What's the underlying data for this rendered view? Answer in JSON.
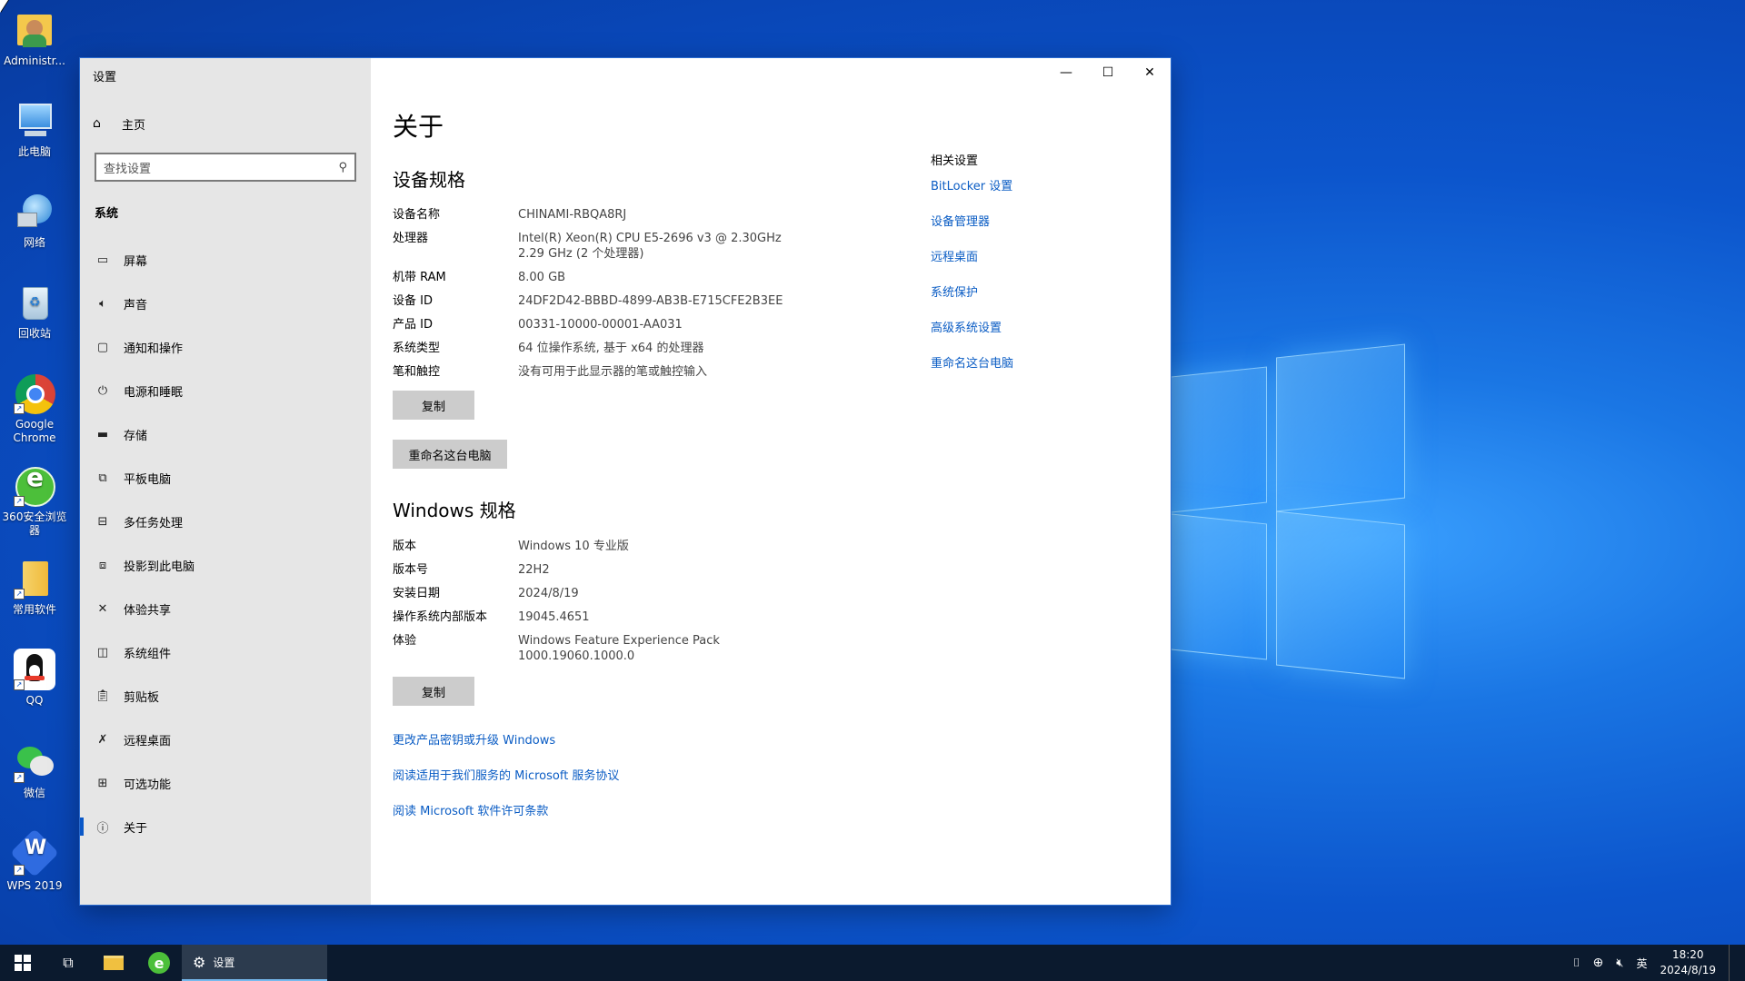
{
  "desktop": {
    "icons": [
      {
        "label": "Administr...",
        "name": "administrator-folder"
      },
      {
        "label": "此电脑",
        "name": "this-pc"
      },
      {
        "label": "网络",
        "name": "network"
      },
      {
        "label": "回收站",
        "name": "recycle-bin"
      },
      {
        "label": "Google Chrome",
        "name": "google-chrome"
      },
      {
        "label": "360安全浏览器",
        "name": "360-browser"
      },
      {
        "label": "常用软件",
        "name": "common-software"
      },
      {
        "label": "QQ",
        "name": "qq"
      },
      {
        "label": "微信",
        "name": "wechat"
      },
      {
        "label": "WPS 2019",
        "name": "wps-2019"
      }
    ]
  },
  "window": {
    "title": "设置",
    "controls": {
      "minimize": "—",
      "maximize": "☐",
      "close": "✕"
    }
  },
  "sidebar": {
    "home_label": "主页",
    "search_placeholder": "查找设置",
    "section": "系统",
    "items": [
      {
        "label": "屏幕",
        "icon": "monitor-icon"
      },
      {
        "label": "声音",
        "icon": "speaker-icon"
      },
      {
        "label": "通知和操作",
        "icon": "notification-icon"
      },
      {
        "label": "电源和睡眠",
        "icon": "power-icon"
      },
      {
        "label": "存储",
        "icon": "storage-icon"
      },
      {
        "label": "平板电脑",
        "icon": "tablet-icon"
      },
      {
        "label": "多任务处理",
        "icon": "multitask-icon"
      },
      {
        "label": "投影到此电脑",
        "icon": "project-icon"
      },
      {
        "label": "体验共享",
        "icon": "share-icon"
      },
      {
        "label": "系统组件",
        "icon": "components-icon"
      },
      {
        "label": "剪贴板",
        "icon": "clipboard-icon"
      },
      {
        "label": "远程桌面",
        "icon": "remote-desktop-icon"
      },
      {
        "label": "可选功能",
        "icon": "optional-features-icon"
      },
      {
        "label": "关于",
        "icon": "info-icon"
      }
    ]
  },
  "main": {
    "title": "关于",
    "device_specs": {
      "heading": "设备规格",
      "rows": [
        {
          "key": "设备名称",
          "value": "CHINAMI-RBQA8RJ"
        },
        {
          "key": "处理器",
          "value": "Intel(R) Xeon(R) CPU E5-2696 v3 @ 2.30GHz   2.29 GHz  (2 个处理器)"
        },
        {
          "key": "机带 RAM",
          "value": "8.00 GB"
        },
        {
          "key": "设备 ID",
          "value": "24DF2D42-BBBD-4899-AB3B-E715CFE2B3EE"
        },
        {
          "key": "产品 ID",
          "value": "00331-10000-00001-AA031"
        },
        {
          "key": "系统类型",
          "value": "64 位操作系统, 基于 x64 的处理器"
        },
        {
          "key": "笔和触控",
          "value": "没有可用于此显示器的笔或触控输入"
        }
      ],
      "copy_button": "复制",
      "rename_button": "重命名这台电脑"
    },
    "windows_specs": {
      "heading": "Windows 规格",
      "rows": [
        {
          "key": "版本",
          "value": "Windows 10 专业版"
        },
        {
          "key": "版本号",
          "value": "22H2"
        },
        {
          "key": "安装日期",
          "value": "2024/8/19"
        },
        {
          "key": "操作系统内部版本",
          "value": "19045.4651"
        },
        {
          "key": "体验",
          "value": "Windows Feature Experience Pack 1000.19060.1000.0"
        }
      ],
      "copy_button": "复制"
    },
    "links": [
      "更改产品密钥或升级 Windows",
      "阅读适用于我们服务的 Microsoft 服务协议",
      "阅读 Microsoft 软件许可条款"
    ],
    "related": {
      "title": "相关设置",
      "links": [
        "BitLocker 设置",
        "设备管理器",
        "远程桌面",
        "系统保护",
        "高级系统设置",
        "重命名这台电脑"
      ]
    }
  },
  "taskbar": {
    "active_app": "设置",
    "ime": "英",
    "time": "18:20",
    "date": "2024/8/19"
  }
}
